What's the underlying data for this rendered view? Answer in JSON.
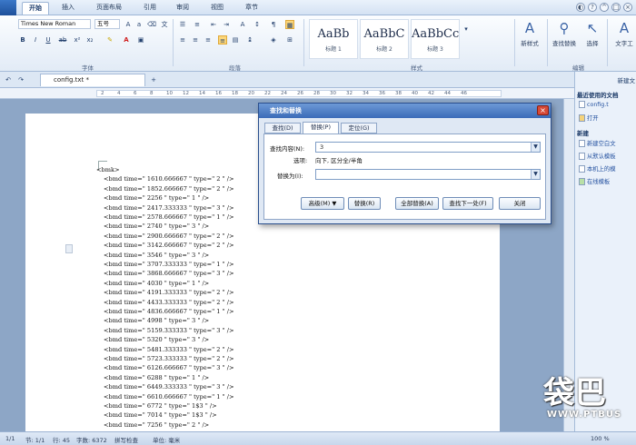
{
  "tabs": [
    "开始",
    "插入",
    "页面布局",
    "引用",
    "审阅",
    "视图",
    "章节"
  ],
  "ribbon": {
    "font_name": "Times New Roman",
    "font_size": "五号",
    "group_font": "字体",
    "group_paragraph": "段落",
    "group_styles": "样式",
    "group_edit": "编辑",
    "styles": [
      {
        "sample": "AaBb",
        "name": "标题 1"
      },
      {
        "sample": "AaBbC",
        "name": "标题 2"
      },
      {
        "sample": "AaBbCc",
        "name": "标题 3"
      }
    ],
    "new_style": "新样式",
    "find_replace": "查找替换",
    "select": "选择",
    "text_tools": "文字工"
  },
  "document": {
    "tab_title": "config.txt *",
    "lines": [
      "<bmk>",
      "<bmd time=\" 1610.666667 \" type=\" 2 \" />",
      "<bmd time=\" 1852.666667 \" type=\" 2 \" />",
      "<bmd time=\" 2256 \" type=\" 1 \" />",
      "<bmd time=\" 2417.333333 \" type=\" 3 \" />",
      "<bmd time=\" 2578.666667 \" type=\" 1 \" />",
      "<bmd time=\" 2740 \" type=\" 3 \" />",
      "<bmd time=\" 2900.666667 \" type=\" 2 \" />",
      "<bmd time=\" 3142.666667 \" type=\" 2 \" />",
      "<bmd time=\" 3546 \" type=\" 3 \" />",
      "<bmd time=\" 3707.333333 \" type=\" 1 \" />",
      "<bmd time=\" 3868.666667 \" type=\" 3 \" />",
      "<bmd time=\" 4030 \" type=\" 1 \" />",
      "<bmd time=\" 4191.333333 \" type=\" 2 \" />",
      "<bmd time=\" 4433.333333 \" type=\" 2 \" />",
      "<bmd time=\" 4836.666667 \" type=\" 1 \" />",
      "<bmd time=\" 4998 \" type=\" 3 \" />",
      "<bmd time=\" 5159.333333 \" type=\" 3 \" />",
      "<bmd time=\" 5320 \" type=\" 3 \" />",
      "<bmd time=\" 5481.333333 \" type=\" 2 \" />",
      "<bmd time=\" 5723.333333 \" type=\" 2 \" />",
      "<bmd time=\" 6126.666667 \" type=\" 3 \" />",
      "<bmd time=\" 6288 \" type=\" 1 \" />",
      "<bmd time=\" 6449.333333 \" type=\" 3 \" />",
      "<bmd time=\" 6610.666667 \" type=\" 1 \" />",
      "<bmd time=\" 6772 \" type=\" 1$3 \" />",
      "<bmd time=\" 7014 \" type=\" 1$3 \" />",
      "<bmd time=\" 7256 \" type=\" 2 \" />"
    ]
  },
  "ruler_ticks": [
    "2",
    "4",
    "6",
    "8",
    "10",
    "12",
    "14",
    "16",
    "18",
    "20",
    "22",
    "24",
    "26",
    "28",
    "30",
    "32",
    "34",
    "36",
    "38",
    "40",
    "42",
    "44",
    "46"
  ],
  "dialog": {
    "title": "查找和替换",
    "tabs": [
      "查找(D)",
      "替换(P)",
      "定位(G)"
    ],
    "find_label": "查找内容(N):",
    "find_value": "3",
    "options_label": "选项:",
    "options_value": "向下, 区分全/半角",
    "replace_label": "替换为(I):",
    "replace_value": "",
    "buttons": [
      "高级(M) ▼",
      "替换(R)",
      "全部替换(A)",
      "查找下一处(F)",
      "关闭"
    ]
  },
  "taskpane": {
    "header": "新建文",
    "recent_title": "最近使用的文档",
    "recent_items": [
      "config.t",
      "打开"
    ],
    "new_title": "新建",
    "new_items": [
      "新建空白文",
      "从默认模板",
      "本机上的模",
      "在线模板"
    ]
  },
  "status": {
    "page": "1/1",
    "section": "节: 1/1",
    "row": "行: 45",
    "words": "字数: 6372",
    "spell": "拼写检查",
    "unit": "单位: 毫米",
    "zoom": "100 %"
  },
  "watermark": {
    "logo": "袋巴",
    "url": "WWW.PTBUS"
  },
  "colors": {
    "ribbon_bg": "#e2ebf6",
    "dialog_title": "#3a6bb8",
    "close_red": "#d64a38",
    "doc_bg": "#8da6c6"
  }
}
